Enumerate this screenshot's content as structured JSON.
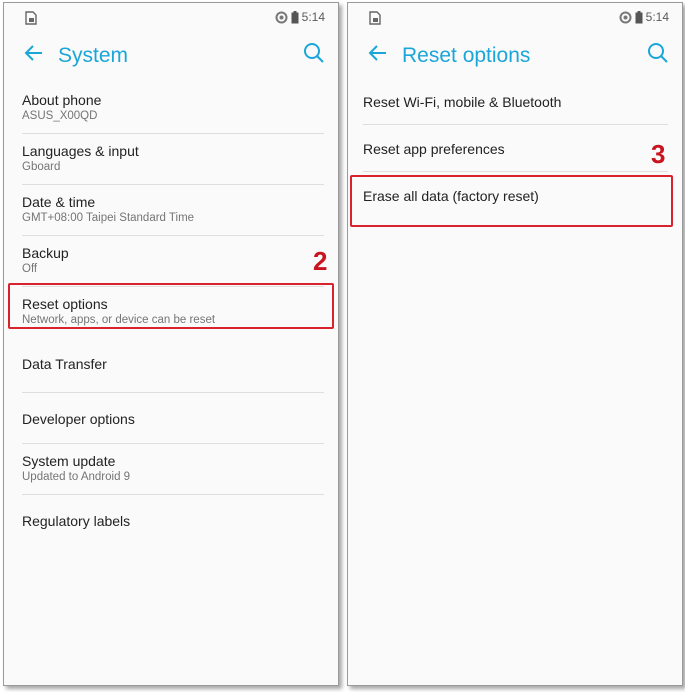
{
  "status_bar": {
    "time": "5:14"
  },
  "left_screen": {
    "title": "System",
    "items": [
      {
        "title": "About phone",
        "subtitle": "ASUS_X00QD"
      },
      {
        "title": "Languages & input",
        "subtitle": "Gboard"
      },
      {
        "title": "Date & time",
        "subtitle": "GMT+08:00 Taipei Standard Time"
      },
      {
        "title": "Backup",
        "subtitle": "Off"
      },
      {
        "title": "Reset options",
        "subtitle": "Network, apps, or device can be reset"
      },
      {
        "title": "Data Transfer"
      },
      {
        "title": "Developer options"
      },
      {
        "title": "System update",
        "subtitle": "Updated to Android 9"
      },
      {
        "title": "Regulatory labels"
      }
    ],
    "step_label": "2"
  },
  "right_screen": {
    "title": "Reset options",
    "items": [
      {
        "title": "Reset Wi-Fi, mobile & Bluetooth"
      },
      {
        "title": "Reset app preferences"
      },
      {
        "title": "Erase all data (factory reset)"
      }
    ],
    "step_label": "3"
  },
  "colors": {
    "accent": "#1ba6d9",
    "highlight": "#d8232f",
    "step": "#c8141e"
  },
  "icons": {
    "back": "back-arrow-icon",
    "search": "search-icon",
    "sim": "sim-card-icon",
    "sync": "sync-icon",
    "battery": "battery-icon"
  }
}
